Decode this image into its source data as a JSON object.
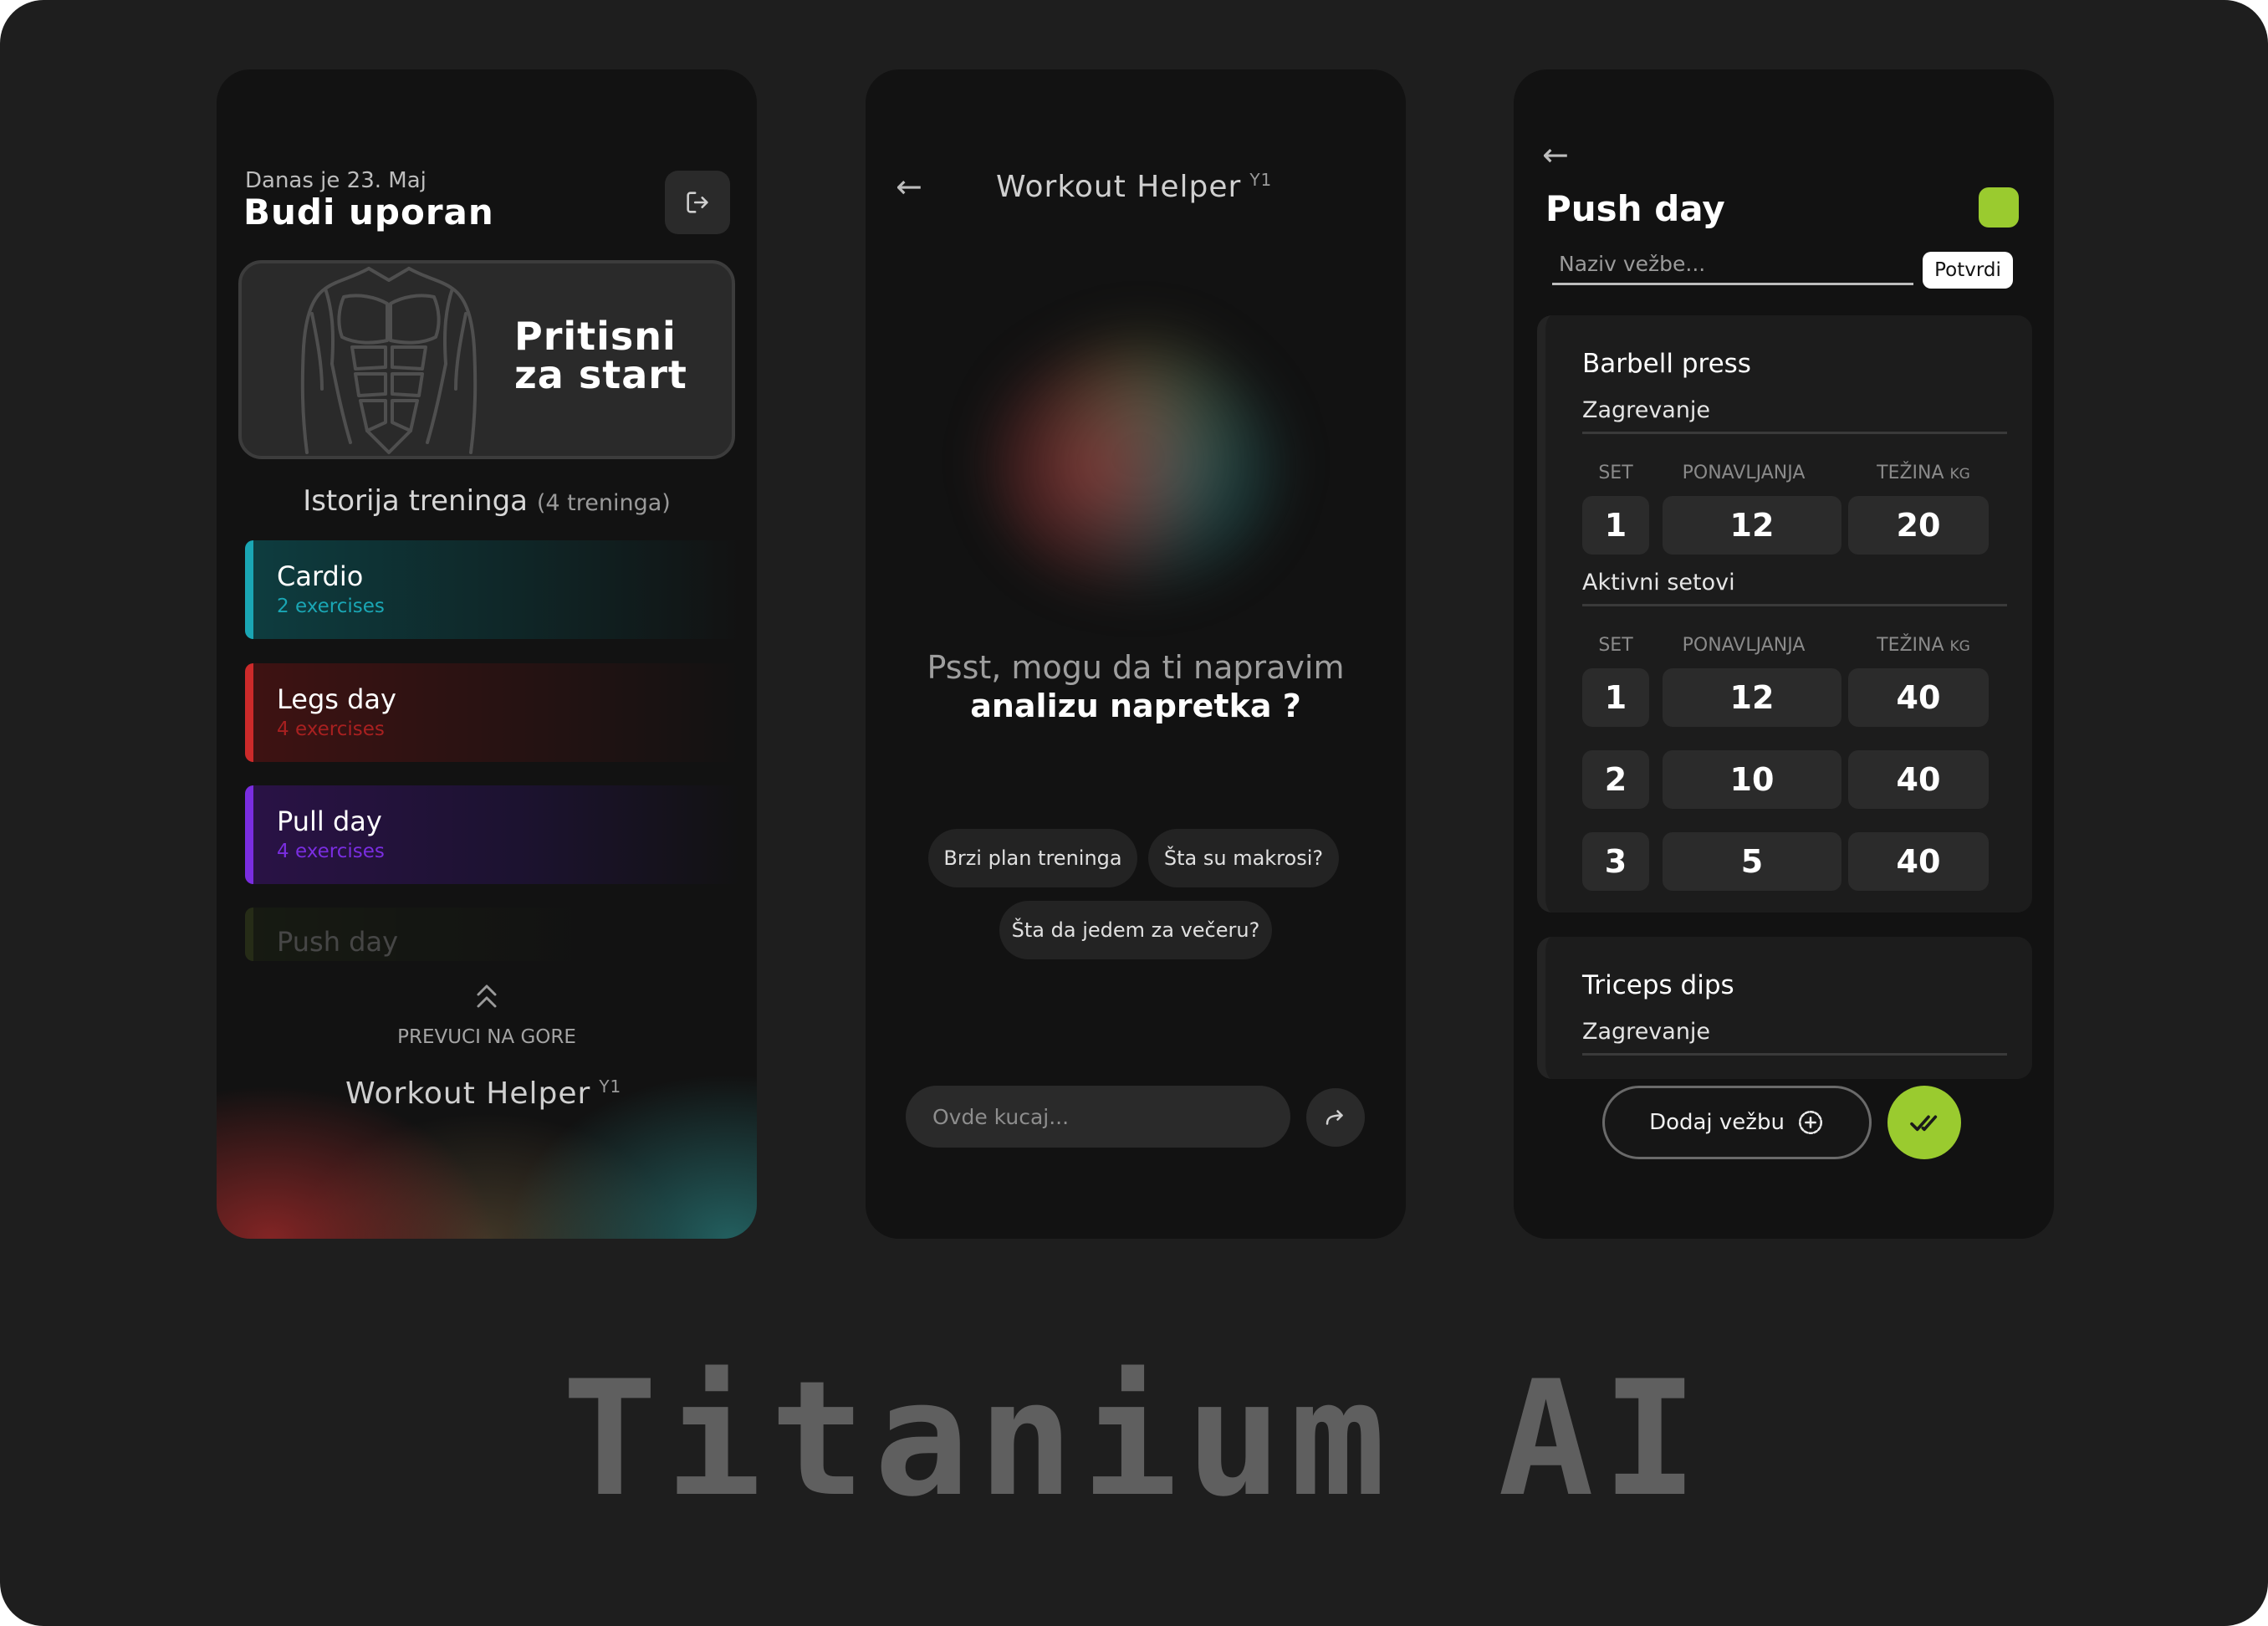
{
  "screen1": {
    "date": "Danas je 23. Maj",
    "greeting": "Budi uporan",
    "start_line1": "Pritisni",
    "start_line2": "za start",
    "history_title": "Istorija treninga",
    "history_count": "(4 treninga)",
    "workouts": [
      {
        "name": "Cardio",
        "sub": "2 exercises",
        "accent": "#1aa6b4"
      },
      {
        "name": "Legs day",
        "sub": "4 exercises",
        "accent": "#cc2a2a"
      },
      {
        "name": "Pull day",
        "sub": "4 exercises",
        "accent": "#7a2de0"
      },
      {
        "name": "Push day",
        "accent": "#6f8a2a"
      }
    ],
    "swipe_hint": "PREVUCI NA GORE",
    "brand": "Workout Helper",
    "brand_version": "Y1"
  },
  "screen2": {
    "title": "Workout Helper",
    "version": "Y1",
    "prompt_line1": "Psst, mogu da ti napravim",
    "prompt_line2": "analizu napretka ?",
    "chips": [
      "Brzi plan treninga",
      "Šta su makrosi?",
      "Šta da jedem za večeru?"
    ],
    "input_placeholder": "Ovde kucaj..."
  },
  "screen3": {
    "title": "Push day",
    "name_placeholder": "Naziv vežbe...",
    "confirm_label": "Potvrdi",
    "exercise1": {
      "name": "Barbell press",
      "warmup_title": "Zagrevanje",
      "col_set": "SET",
      "col_reps": "PONAVLJANJA",
      "col_weight": "TEŽINA",
      "col_unit": "KG",
      "warmup": [
        {
          "set": "1",
          "reps": "12",
          "weight": "20"
        }
      ],
      "active_title": "Aktivni setovi",
      "active": [
        {
          "set": "1",
          "reps": "12",
          "weight": "40"
        },
        {
          "set": "2",
          "reps": "10",
          "weight": "40"
        },
        {
          "set": "3",
          "reps": "5",
          "weight": "40"
        }
      ]
    },
    "exercise2": {
      "name": "Triceps dips",
      "warmup_title": "Zagrevanje"
    },
    "add_label": "Dodaj vežbu",
    "accent": "#9acb2f"
  },
  "footer_title": "Titanium AI"
}
